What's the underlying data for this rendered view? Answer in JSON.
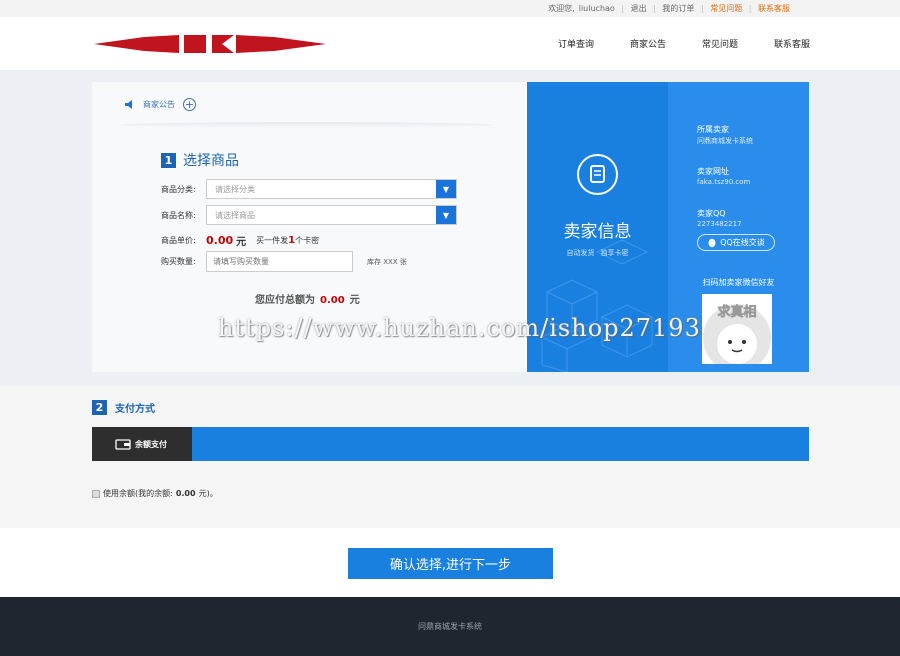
{
  "topbar": {
    "welcome": "欢迎您,",
    "username": "liuluchao",
    "logout": "退出",
    "my_orders": "我的订单",
    "faq": "常见问题",
    "contact": "联系客服"
  },
  "nav": [
    "订单查询",
    "商家公告",
    "常见问题",
    "联系客服"
  ],
  "notice": {
    "label": "商家公告"
  },
  "section1": {
    "number": "1",
    "title": "选择商品",
    "category_label": "商品分类:",
    "category_placeholder": "请选择分类",
    "product_label": "商品名称:",
    "product_placeholder": "请选择商品",
    "price_label": "商品单价:",
    "price_value": "0.00",
    "price_unit": "元",
    "bulk_prefix": "买一件发",
    "bulk_count": "1",
    "bulk_suffix": "个卡密",
    "qty_label": "购买数量:",
    "qty_placeholder": "请填写购买数量",
    "stock": "库存 XXX 张",
    "total_label": "您应付总额为",
    "total_value": "0.00",
    "total_unit": "元"
  },
  "seller": {
    "title": "卖家信息",
    "tags": [
      "自动发货",
      "独享卡密"
    ],
    "shop_label": "所属卖家",
    "shop_value": "问鼎商城发卡系统",
    "site_label": "卖家网址",
    "site_value": "faka.tsz90.com",
    "qq_label": "卖家QQ",
    "qq_value": "2273482217",
    "qq_button": "QQ在线交谈",
    "scan_text": "扫码加卖家微信好友",
    "qr_text": "求真相"
  },
  "section2": {
    "number": "2",
    "title": "支付方式",
    "pay_tab": "余额支付",
    "balance_prefix": "使用余额(我的余额:",
    "balance_value": "0.00",
    "balance_suffix": "元)。"
  },
  "confirm_button": "确认选择,进行下一步",
  "footer": "问鼎商城发卡系统",
  "watermark": "https://www.huzhan.com/ishop27193",
  "colors": {
    "accent": "#1a80e0",
    "price": "#cc0000",
    "footer_bg": "#1f2630",
    "logo_red": "#c0141e"
  }
}
